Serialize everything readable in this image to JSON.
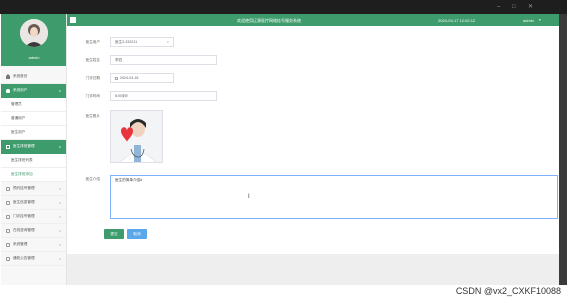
{
  "window": {
    "controls": [
      "–",
      "□",
      "✕"
    ]
  },
  "sidebar": {
    "username": "admin",
    "items": [
      {
        "label": "系统首页",
        "icon": "home-icon",
        "type": "top"
      },
      {
        "label": "系统用户",
        "icon": "user-icon",
        "type": "group-open"
      },
      {
        "label": "管理员",
        "type": "sub"
      },
      {
        "label": "普通用户",
        "type": "sub"
      },
      {
        "label": "医生用户",
        "type": "sub"
      },
      {
        "label": "医生排班管理",
        "icon": "doc-icon",
        "type": "group-open"
      },
      {
        "label": "医生排班列表",
        "type": "sub"
      },
      {
        "label": "医生排班添加",
        "type": "sub-selected"
      },
      {
        "label": "预约挂号管理",
        "type": "group"
      },
      {
        "label": "医生信息管理",
        "type": "group"
      },
      {
        "label": "门诊挂号管理",
        "type": "group"
      },
      {
        "label": "在线咨询管理",
        "type": "group"
      },
      {
        "label": "系统管理",
        "type": "group"
      },
      {
        "label": "通知公告管理",
        "type": "group"
      }
    ]
  },
  "header": {
    "title": "欢迎使用辽源医疗网络挂号服务系统",
    "datetime": "2024-03-17 12:02:12",
    "user": "admin",
    "caret": "▾"
  },
  "form": {
    "doctor_user_label": "医生用户",
    "doctor_user_value": "医生3-332211",
    "doctor_name_label": "医生姓名",
    "doctor_name_value": "李四",
    "clinic_date_label": "门诊日期",
    "clinic_date_value": "2024-03-18",
    "clinic_time_label": "门诊时间",
    "clinic_time_value": "8:00到9",
    "photo_label": "医生照片",
    "intro_label": "医生介绍",
    "intro_value": "医生的简单介绍#",
    "submit_label": "提交",
    "cancel_label": "取消"
  },
  "watermark": "CSDN @vx2_CXKF10088",
  "colors": {
    "accent": "#3d9b6c",
    "button_blue": "#5aa8ea",
    "focus_border": "#7fb0ff"
  }
}
